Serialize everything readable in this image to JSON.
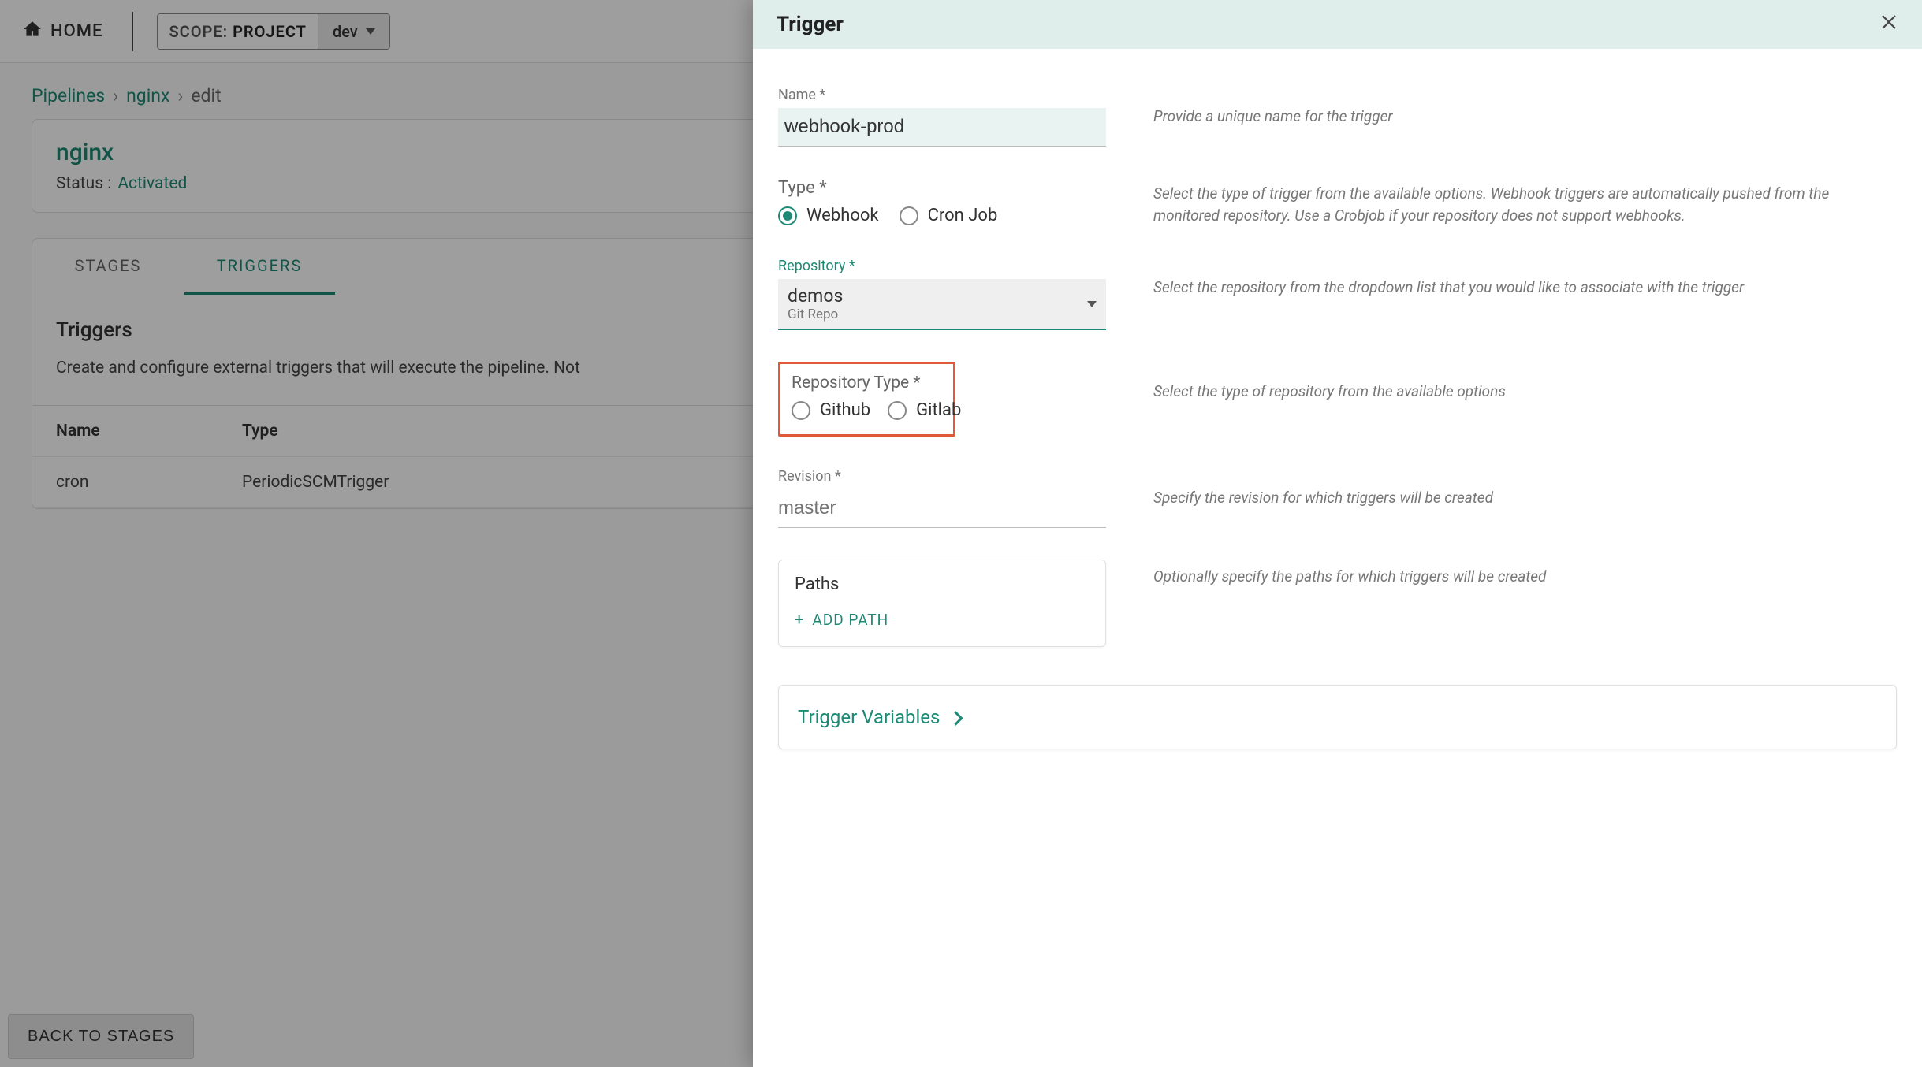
{
  "topbar": {
    "home_label": "HOME",
    "scope_prefix": "SCOPE:",
    "scope_value": "PROJECT",
    "scope_selected": "dev"
  },
  "breadcrumb": {
    "item1": "Pipelines",
    "item2": "nginx",
    "item3": "edit",
    "sep": "›"
  },
  "pipeline_panel": {
    "title": "nginx",
    "status_label": "Status :",
    "status_value": "Activated"
  },
  "tabs": {
    "stages": "STAGES",
    "triggers": "TRIGGERS"
  },
  "triggers_section": {
    "heading": "Triggers",
    "description": "Create and configure external triggers that will execute the pipeline. Not"
  },
  "table": {
    "headers": {
      "name": "Name",
      "type": "Type"
    },
    "row1": {
      "name": "cron",
      "type": "PeriodicSCMTrigger"
    }
  },
  "back_button": "BACK TO STAGES",
  "drawer": {
    "title": "Trigger",
    "name": {
      "label": "Name *",
      "value": "webhook-prod",
      "helper": "Provide a unique name for the trigger"
    },
    "type": {
      "label": "Type *",
      "option_webhook": "Webhook",
      "option_cron": "Cron Job",
      "helper": "Select the type of trigger from the available options. Webhook triggers are automatically pushed from the monitored repository. Use a Crobjob if your repository does not support webhooks."
    },
    "repository": {
      "label": "Repository *",
      "value": "demos",
      "sub": "Git Repo",
      "helper": "Select the repository from the dropdown list that you would like to associate with the trigger"
    },
    "repo_type": {
      "label": "Repository Type *",
      "option_github": "Github",
      "option_gitlab": "Gitlab",
      "helper": "Select the type of repository from the available options"
    },
    "revision": {
      "label": "Revision *",
      "placeholder": "master",
      "helper": "Specify the revision for which triggers will be created"
    },
    "paths": {
      "title": "Paths",
      "add_label": "ADD  PATH",
      "helper": "Optionally specify the paths for which triggers will be created"
    },
    "trigger_vars": "Trigger Variables"
  }
}
